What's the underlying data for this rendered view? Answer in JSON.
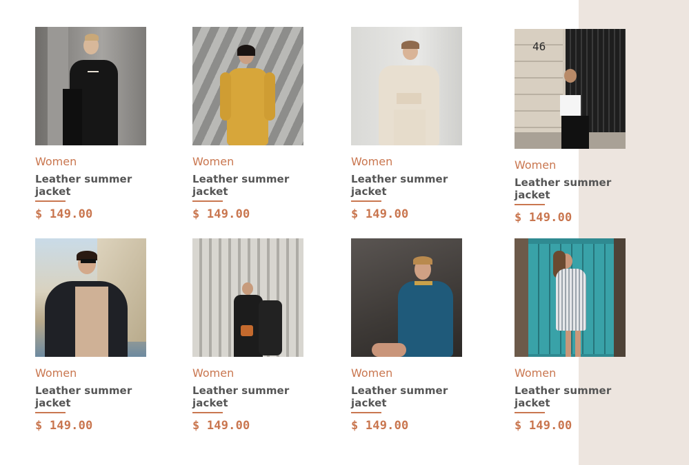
{
  "colors": {
    "accent": "#c9764f",
    "title": "#555555",
    "panel": "#ede5df"
  },
  "products": [
    {
      "category": "Women",
      "name": "Leather summer jacket",
      "price": "$ 149.00",
      "image": "woman-black-outfit-photo"
    },
    {
      "category": "Women",
      "name": "Leather summer jacket",
      "price": "$ 149.00",
      "image": "woman-yellow-dress-photo"
    },
    {
      "category": "Women",
      "name": "Leather summer jacket",
      "price": "$ 149.00",
      "image": "woman-beige-set-photo"
    },
    {
      "category": "Women",
      "name": "Leather summer jacket",
      "price": "$ 149.00",
      "image": "woman-door-46-photo"
    },
    {
      "category": "Women",
      "name": "Leather summer jacket",
      "price": "$ 149.00",
      "image": "woman-cape-cliffs-photo"
    },
    {
      "category": "Women",
      "name": "Leather summer jacket",
      "price": "$ 149.00",
      "image": "woman-black-suit-photo"
    },
    {
      "category": "Women",
      "name": "Leather summer jacket",
      "price": "$ 149.00",
      "image": "woman-blue-dress-photo"
    },
    {
      "category": "Women",
      "name": "Leather summer jacket",
      "price": "$ 149.00",
      "image": "woman-teal-door-photo"
    }
  ],
  "door_number": "46"
}
